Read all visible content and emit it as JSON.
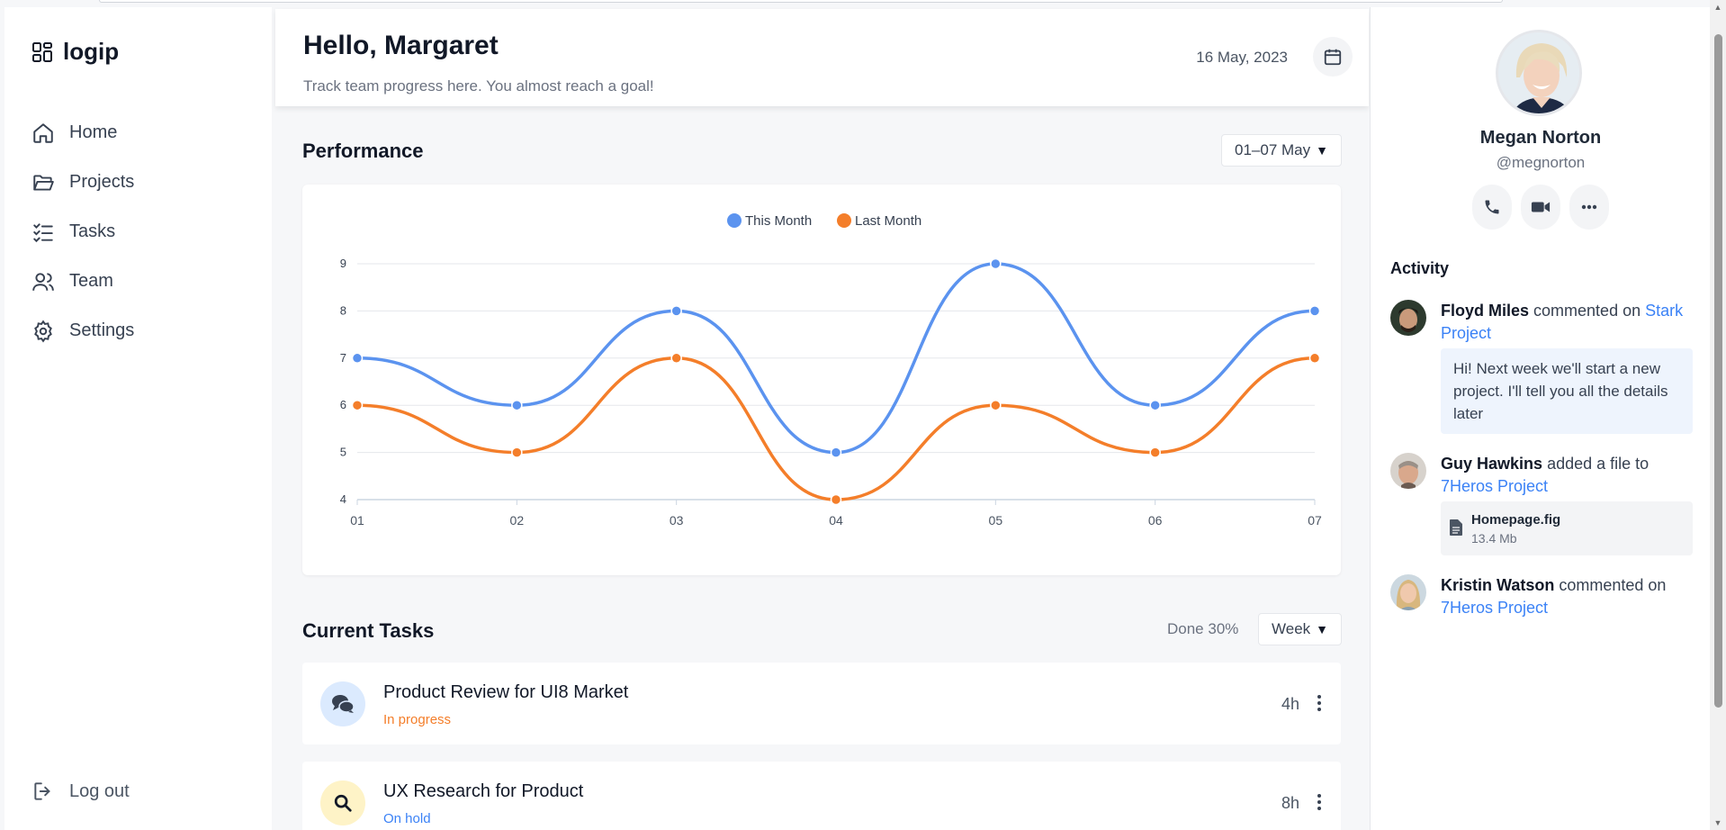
{
  "app": {
    "logo": "logip"
  },
  "sidebar": {
    "items": [
      {
        "label": "Home",
        "icon": "home-icon"
      },
      {
        "label": "Projects",
        "icon": "folder-icon"
      },
      {
        "label": "Tasks",
        "icon": "checklist-icon"
      },
      {
        "label": "Team",
        "icon": "users-icon"
      },
      {
        "label": "Settings",
        "icon": "gear-icon"
      }
    ],
    "logout": "Log out"
  },
  "header": {
    "greeting": "Hello, Margaret",
    "subtitle": "Track team progress here. You almost reach a goal!",
    "date": "16 May, 2023"
  },
  "performance": {
    "title": "Performance",
    "range": "01–07 May"
  },
  "chart_data": {
    "type": "line",
    "x": [
      "01",
      "02",
      "03",
      "04",
      "05",
      "06",
      "07"
    ],
    "series": [
      {
        "name": "This Month",
        "color": "#5b93ef",
        "values": [
          7,
          6,
          8,
          5,
          9,
          6,
          8
        ]
      },
      {
        "name": "Last Month",
        "color": "#f47e2a",
        "values": [
          6,
          5,
          7,
          4,
          6,
          5,
          7
        ]
      }
    ],
    "ylim": [
      4,
      9
    ],
    "yticks": [
      "4",
      "5",
      "6",
      "7",
      "8",
      "9"
    ],
    "grid": true,
    "legend": "top-center"
  },
  "tasks": {
    "title": "Current Tasks",
    "done": "Done 30%",
    "period": "Week",
    "items": [
      {
        "title": "Product Review for UI8 Market",
        "status": "In progress",
        "status_color": "#f47e2a",
        "time": "4h",
        "icon": "chat-bubbles-icon",
        "icon_bg": "#dbeafe"
      },
      {
        "title": "UX Research for Product",
        "status": "On hold",
        "status_color": "#3b82f6",
        "time": "8h",
        "icon": "search-icon",
        "icon_bg": "#fef3c7"
      }
    ]
  },
  "profile": {
    "name": "Megan Norton",
    "handle": "@megnorton"
  },
  "activity": {
    "title": "Activity",
    "items": [
      {
        "name": "Floyd Miles",
        "action": "commented on",
        "link": "Stark Project",
        "comment": "Hi! Next week we'll start a new project. I'll tell you all the details later"
      },
      {
        "name": "Guy Hawkins",
        "action": "added a file to",
        "link": "7Heros Project",
        "file_name": "Homepage.fig",
        "file_size": "13.4 Mb"
      },
      {
        "name": "Kristin Watson",
        "action": "commented on",
        "link": "7Heros Project"
      }
    ]
  }
}
